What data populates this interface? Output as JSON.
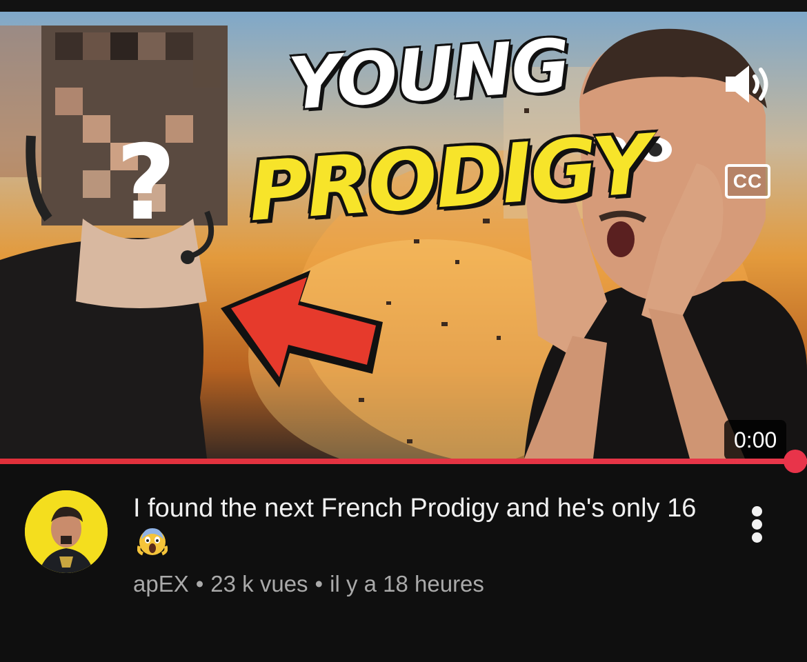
{
  "player": {
    "thumbnail_text_line1": "YOUNG",
    "thumbnail_text_line2": "PRODIGY",
    "thumbnail_question_mark": "?",
    "cc_label": "CC",
    "time": "0:00",
    "progress": 1.0,
    "colors": {
      "progress": "#e8344a",
      "title_yellow": "#f7e42a"
    },
    "icons": {
      "volume": "volume-high-icon",
      "cc": "closed-captions-icon"
    }
  },
  "video": {
    "title": "I found the next French Prodigy and he's only 16",
    "title_emoji": "face-screaming-in-fear-emoji",
    "channel": "apEX",
    "views": "23 k vues",
    "age": "il y a 18 heures",
    "separator": "•",
    "more_icon": "more-vertical-icon"
  },
  "channel_avatar": {
    "background": "#f4de1e"
  }
}
